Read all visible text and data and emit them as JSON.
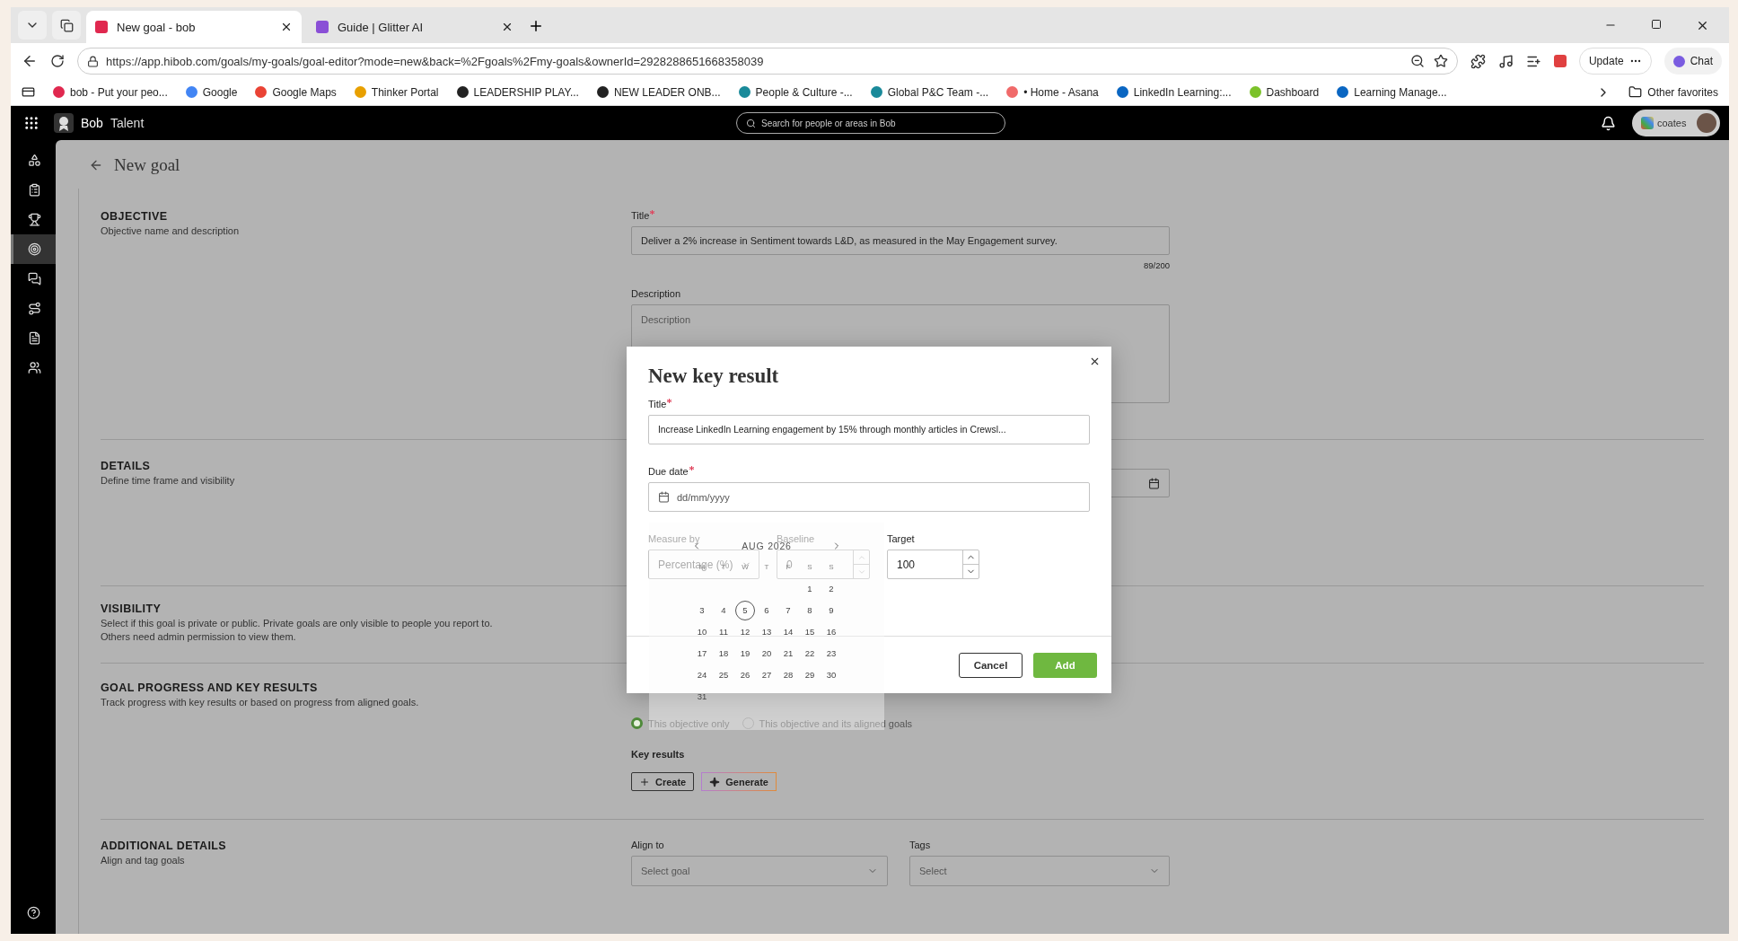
{
  "browser": {
    "tabs": [
      {
        "title": "New goal - bob",
        "selected": true
      },
      {
        "title": "Guide | Glitter AI",
        "selected": false
      }
    ],
    "url": "https://app.hibob.com/goals/my-goals/goal-editor?mode=new&back=%2Fgoals%2Fmy-goals&ownerId=2928288651668358039",
    "update_label": "Update",
    "chat_label": "Chat",
    "bookmarks": [
      {
        "label": "bob - Put your peo..."
      },
      {
        "label": "Google"
      },
      {
        "label": "Google Maps"
      },
      {
        "label": "Thinker Portal"
      },
      {
        "label": "LEADERSHIP PLAY..."
      },
      {
        "label": "NEW LEADER ONB..."
      },
      {
        "label": "People & Culture -..."
      },
      {
        "label": "Global P&C Team -..."
      },
      {
        "label": "• Home - Asana"
      },
      {
        "label": "LinkedIn Learning:..."
      },
      {
        "label": "Dashboard"
      },
      {
        "label": "Learning Manage..."
      }
    ],
    "other_favorites": "Other favorites"
  },
  "app": {
    "brand": "Bob",
    "module": "Talent",
    "search_placeholder": "Search for people or areas in Bob",
    "company": "coates",
    "nav": [
      {
        "selected": false
      },
      {
        "selected": false
      },
      {
        "selected": false
      },
      {
        "selected": true
      },
      {
        "selected": false
      },
      {
        "selected": false
      },
      {
        "selected": false
      },
      {
        "selected": false
      }
    ]
  },
  "page": {
    "title": "New goal"
  },
  "objective": {
    "heading": "OBJECTIVE",
    "description": "Objective name and description",
    "title_field": {
      "label": "Title",
      "required": true,
      "value": "Deliver a 2% increase in Sentiment towards L&D, as measured in the May Engagement survey.",
      "counter": "89/200"
    },
    "description_field": {
      "label": "Description",
      "placeholder": "Description"
    }
  },
  "details": {
    "heading": "DETAILS",
    "description": "Define time frame and visibility"
  },
  "visibility": {
    "heading": "VISIBILITY",
    "description": "Select if this goal is private or public. Private goals are only visible to people you report to. Others need admin permission to view them."
  },
  "progress": {
    "heading": "GOAL PROGRESS AND KEY RESULTS",
    "description": "Track progress with key results or based on progress from aligned goals.",
    "options": [
      {
        "label": "This objective only",
        "selected": true
      },
      {
        "label": "This objective and its aligned goals",
        "selected": false
      }
    ],
    "key_results_label": "Key results",
    "buttons": [
      {
        "label": "Create",
        "kind": "create"
      },
      {
        "label": "Generate",
        "kind": "generate"
      }
    ]
  },
  "additional": {
    "heading": "ADDITIONAL DETAILS",
    "description": "Align and tag goals",
    "fields": [
      {
        "label": "Align to",
        "placeholder": "Select goal"
      },
      {
        "label": "Tags",
        "placeholder": "Select"
      }
    ]
  },
  "modal": {
    "title": "New key result",
    "title_field": {
      "label": "Title",
      "required": true,
      "value": "Increase LinkedIn Learning engagement by 15% through monthly articles in Crewsl..."
    },
    "due_field": {
      "label": "Due date",
      "required": true,
      "placeholder": "dd/mm/yyyy"
    },
    "measure_field": {
      "label": "Measure by",
      "value": "Percentage (%)"
    },
    "baseline_field": {
      "label": "Baseline",
      "value": "0"
    },
    "target_field": {
      "label": "Target",
      "value": "100"
    },
    "cancel_label": "Cancel",
    "add_label": "Add"
  },
  "calendar": {
    "month": "AUG 2026",
    "weekdays": [
      "M",
      "T",
      "W",
      "T",
      "F",
      "S",
      "S"
    ],
    "weeks": [
      [
        {
          "day": "1",
          "today": false
        },
        {
          "day": "2",
          "today": false
        }
      ],
      [
        {
          "day": "3",
          "today": false
        },
        {
          "day": "4",
          "today": false
        },
        {
          "day": "5",
          "today": true
        },
        {
          "day": "6",
          "today": false
        },
        {
          "day": "7",
          "today": false
        },
        {
          "day": "8",
          "today": false
        },
        {
          "day": "9",
          "today": false
        }
      ],
      [
        {
          "day": "10",
          "today": false
        },
        {
          "day": "11",
          "today": false
        },
        {
          "day": "12",
          "today": false
        },
        {
          "day": "13",
          "today": false
        },
        {
          "day": "14",
          "today": false
        },
        {
          "day": "15",
          "today": false
        },
        {
          "day": "16",
          "today": false
        }
      ],
      [
        {
          "day": "17",
          "today": false
        },
        {
          "day": "18",
          "today": false
        },
        {
          "day": "19",
          "today": false
        },
        {
          "day": "20",
          "today": false
        },
        {
          "day": "21",
          "today": false
        },
        {
          "day": "22",
          "today": false
        },
        {
          "day": "23",
          "today": false
        }
      ],
      [
        {
          "day": "24",
          "today": false
        },
        {
          "day": "25",
          "today": false
        },
        {
          "day": "26",
          "today": false
        },
        {
          "day": "27",
          "today": false
        },
        {
          "day": "28",
          "today": false
        },
        {
          "day": "29",
          "today": false
        },
        {
          "day": "30",
          "today": false
        }
      ],
      [
        {
          "day": "31",
          "today": false
        }
      ]
    ]
  }
}
